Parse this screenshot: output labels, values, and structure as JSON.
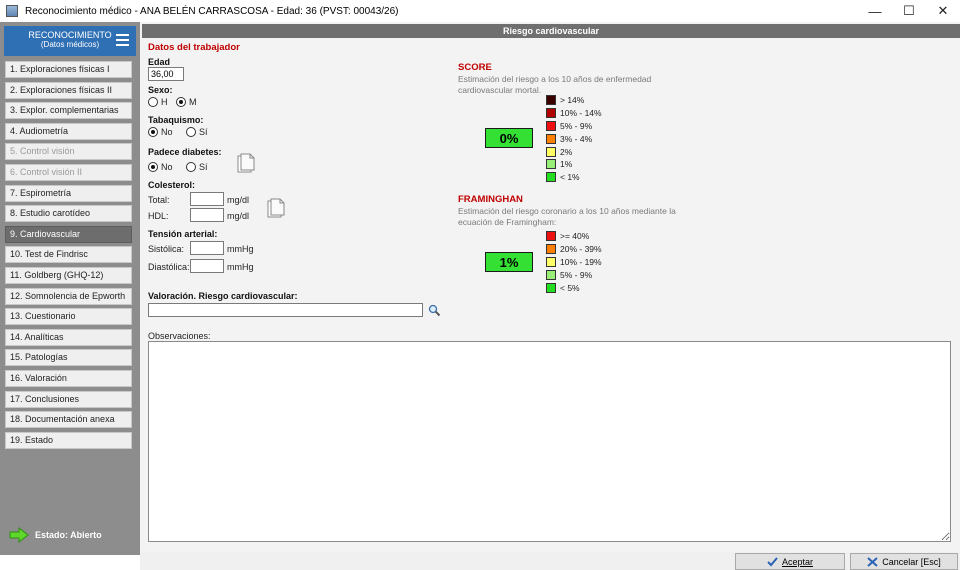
{
  "window": {
    "title": "Reconocimiento médico - ANA BELÉN CARRASCOSA  -  Edad: 36  (PVST: 00043/26)",
    "minimize": "—",
    "maximize": "☐",
    "close": "✕"
  },
  "sidebar": {
    "header_line1": "RECONOCIMIENTO",
    "header_line2": "(Datos médicos)",
    "items": [
      {
        "label": "1. Exploraciones físicas I"
      },
      {
        "label": "2. Exploraciones físicas II"
      },
      {
        "label": "3. Explor. complementarias"
      },
      {
        "label": "4. Audiometría"
      },
      {
        "label": "5. Control visión"
      },
      {
        "label": "6. Control visión II"
      },
      {
        "label": "7. Espirometría"
      },
      {
        "label": "8. Estudio carotídeo"
      },
      {
        "label": "9. Cardiovascular"
      },
      {
        "label": "10. Test de Findrisc"
      },
      {
        "label": "11. Goldberg (GHQ-12)"
      },
      {
        "label": "12. Somnolencia de Epworth"
      },
      {
        "label": "13. Cuestionario"
      },
      {
        "label": "14. Analíticas"
      },
      {
        "label": "15. Patologías"
      },
      {
        "label": "16. Valoración"
      },
      {
        "label": "17. Conclusiones"
      },
      {
        "label": "18. Documentación anexa"
      },
      {
        "label": "19. Estado"
      }
    ],
    "estado": "Estado: Abierto"
  },
  "panel": {
    "title": "Riesgo cardiovascular",
    "worker_section": "Datos del trabajador",
    "edad_label": "Edad",
    "edad_value": "36,00",
    "sexo_label": "Sexo:",
    "sexo_h": "H",
    "sexo_m": "M",
    "tabaquismo_label": "Tabaquismo:",
    "no_label": "No",
    "si_label": "Sí",
    "diabetes_label": "Padece diabetes:",
    "colesterol_label": "Colesterol:",
    "total_label": "Total:",
    "hdl_label": "HDL:",
    "mgdl": "mg/dl",
    "tension_label": "Tensión arterial:",
    "sistolica_label": "Sistólica:",
    "diastolica_label": "Diastólica:",
    "mmhg": "mmHg",
    "valoracion_label": "Valoración. Riesgo cardiovascular:",
    "valoracion_value": "",
    "observaciones_label": "Observaciones:"
  },
  "score": {
    "title": "SCORE",
    "description": "Estimación del riesgo a los 10 años de enfermedad cardiovascular mortal.",
    "result": "0%",
    "legend": [
      {
        "label": "> 14%",
        "color": "#3a0000"
      },
      {
        "label": "10% - 14%",
        "color": "#b00000"
      },
      {
        "label": "5% - 9%",
        "color": "#ee1010"
      },
      {
        "label": "3% - 4%",
        "color": "#ff8000"
      },
      {
        "label": "2%",
        "color": "#ffff66"
      },
      {
        "label": "1%",
        "color": "#99ee77"
      },
      {
        "label": "< 1%",
        "color": "#22dd22"
      }
    ]
  },
  "framingham": {
    "title": "FRAMINGHAN",
    "description": "Estimación del riesgo coronario a los 10 años mediante la ecuación de Framingham:",
    "result": "1%",
    "legend": [
      {
        "label": ">= 40%",
        "color": "#ee1010"
      },
      {
        "label": "20% - 39%",
        "color": "#ff8000"
      },
      {
        "label": "10% - 19%",
        "color": "#ffff66"
      },
      {
        "label": "5% - 9%",
        "color": "#99ee77"
      },
      {
        "label": "< 5%",
        "color": "#22dd22"
      }
    ]
  },
  "buttons": {
    "aceptar": "Aceptar",
    "cancelar": "Cancelar [Esc]"
  }
}
